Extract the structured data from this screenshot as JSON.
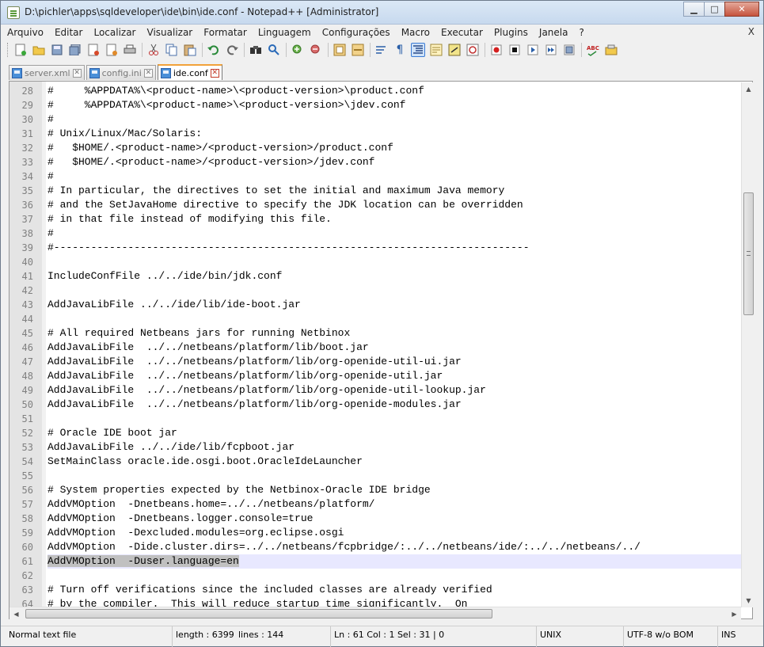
{
  "window": {
    "title": "D:\\pichler\\apps\\sqldeveloper\\ide\\bin\\ide.conf - Notepad++ [Administrator]",
    "minimize": "▁",
    "maximize": "□",
    "close": "✕"
  },
  "menu": {
    "items": [
      "Arquivo",
      "Editar",
      "Localizar",
      "Visualizar",
      "Formatar",
      "Linguagem",
      "Configurações",
      "Macro",
      "Executar",
      "Plugins",
      "Janela",
      "?"
    ],
    "close": "X"
  },
  "toolbar": {
    "icons": [
      "new-file-icon",
      "open-file-icon",
      "save-icon",
      "save-all-icon",
      "close-icon",
      "close-all-icon",
      "print-icon",
      "cut-icon",
      "copy-icon",
      "paste-icon",
      "undo-icon",
      "redo-icon",
      "find-icon",
      "replace-icon",
      "zoom-in-icon",
      "zoom-out-icon",
      "sync-vertical-icon",
      "sync-horizontal-icon",
      "word-wrap-icon",
      "show-all-chars-icon",
      "indent-guide-icon",
      "doc-map-icon",
      "function-list-icon",
      "folder-workspace-icon",
      "record-macro-icon",
      "stop-record-icon",
      "play-macro-icon",
      "play-macro-multiple-icon",
      "save-macro-icon",
      "spell-check-icon",
      "misc-plugin-icon"
    ]
  },
  "tabs": [
    {
      "label": "server.xml",
      "active": false
    },
    {
      "label": "config.ini",
      "active": false
    },
    {
      "label": "ide.conf",
      "active": true
    }
  ],
  "editor": {
    "current_line": 61,
    "lines": [
      {
        "n": "28",
        "t": "#     %APPDATA%\\<product-name>\\<product-version>\\product.conf"
      },
      {
        "n": "29",
        "t": "#     %APPDATA%\\<product-name>\\<product-version>\\jdev.conf"
      },
      {
        "n": "30",
        "t": "#"
      },
      {
        "n": "31",
        "t": "# Unix/Linux/Mac/Solaris:"
      },
      {
        "n": "32",
        "t": "#   $HOME/.<product-name>/<product-version>/product.conf"
      },
      {
        "n": "33",
        "t": "#   $HOME/.<product-name>/<product-version>/jdev.conf"
      },
      {
        "n": "34",
        "t": "#"
      },
      {
        "n": "35",
        "t": "# In particular, the directives to set the initial and maximum Java memory"
      },
      {
        "n": "36",
        "t": "# and the SetJavaHome directive to specify the JDK location can be overridden"
      },
      {
        "n": "37",
        "t": "# in that file instead of modifying this file."
      },
      {
        "n": "38",
        "t": "#"
      },
      {
        "n": "39",
        "t": "#-----------------------------------------------------------------------------"
      },
      {
        "n": "40",
        "t": ""
      },
      {
        "n": "41",
        "t": "IncludeConfFile ../../ide/bin/jdk.conf"
      },
      {
        "n": "42",
        "t": ""
      },
      {
        "n": "43",
        "t": "AddJavaLibFile ../../ide/lib/ide-boot.jar"
      },
      {
        "n": "44",
        "t": ""
      },
      {
        "n": "45",
        "t": "# All required Netbeans jars for running Netbinox"
      },
      {
        "n": "46",
        "t": "AddJavaLibFile  ../../netbeans/platform/lib/boot.jar"
      },
      {
        "n": "47",
        "t": "AddJavaLibFile  ../../netbeans/platform/lib/org-openide-util-ui.jar"
      },
      {
        "n": "48",
        "t": "AddJavaLibFile  ../../netbeans/platform/lib/org-openide-util.jar"
      },
      {
        "n": "49",
        "t": "AddJavaLibFile  ../../netbeans/platform/lib/org-openide-util-lookup.jar"
      },
      {
        "n": "50",
        "t": "AddJavaLibFile  ../../netbeans/platform/lib/org-openide-modules.jar"
      },
      {
        "n": "51",
        "t": ""
      },
      {
        "n": "52",
        "t": "# Oracle IDE boot jar"
      },
      {
        "n": "53",
        "t": "AddJavaLibFile ../../ide/lib/fcpboot.jar"
      },
      {
        "n": "54",
        "t": "SetMainClass oracle.ide.osgi.boot.OracleIdeLauncher"
      },
      {
        "n": "55",
        "t": ""
      },
      {
        "n": "56",
        "t": "# System properties expected by the Netbinox-Oracle IDE bridge"
      },
      {
        "n": "57",
        "t": "AddVMOption  -Dnetbeans.home=../../netbeans/platform/"
      },
      {
        "n": "58",
        "t": "AddVMOption  -Dnetbeans.logger.console=true"
      },
      {
        "n": "59",
        "t": "AddVMOption  -Dexcluded.modules=org.eclipse.osgi"
      },
      {
        "n": "60",
        "t": "AddVMOption  -Dide.cluster.dirs=../../netbeans/fcpbridge/:../../netbeans/ide/:../../netbeans/../"
      },
      {
        "n": "61",
        "t": "AddVMOption  -Duser.language=en"
      },
      {
        "n": "62",
        "t": ""
      },
      {
        "n": "63",
        "t": "# Turn off verifications since the included classes are already verified"
      },
      {
        "n": "64",
        "t": "# by the compiler.  This will reduce startup time significantly.  On"
      }
    ]
  },
  "status": {
    "type": "Normal text file",
    "length": "length : 6399",
    "lines": "lines : 144",
    "position": "Ln : 61    Col : 1    Sel : 31 | 0",
    "eol": "UNIX",
    "encoding": "UTF-8 w/o BOM",
    "mode": "INS"
  },
  "scrollbars": {
    "up": "▲",
    "down": "▼",
    "left": "◀",
    "right": "▶"
  }
}
